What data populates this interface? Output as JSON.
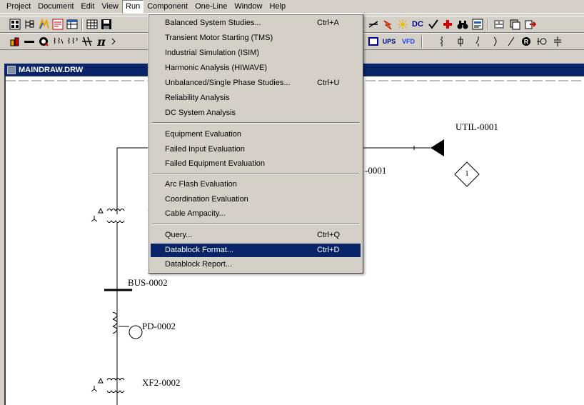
{
  "menubar": {
    "items": [
      "Project",
      "Document",
      "Edit",
      "View",
      "Run",
      "Component",
      "One-Line",
      "Window",
      "Help"
    ],
    "active": "Run"
  },
  "toolbar2": {
    "ups": "UPS",
    "vfd": "VFD"
  },
  "document": {
    "title": "MAINDRAW.DRW"
  },
  "diagram": {
    "util_label": "UTIL-0001",
    "util_partial_label": "-0001",
    "diamond_number": "1",
    "xf1_partial": "X",
    "bus_label": "BUS-0002",
    "pd_label": "PD-0002",
    "xf2_label": "XF2-0002"
  },
  "run_menu": {
    "items": [
      {
        "label": "Balanced System Studies...",
        "shortcut": "Ctrl+A"
      },
      {
        "label": "Transient Motor Starting (TMS)",
        "shortcut": ""
      },
      {
        "label": "Industrial Simulation (ISIM)",
        "shortcut": ""
      },
      {
        "label": "Harmonic Analysis (HIWAVE)",
        "shortcut": ""
      },
      {
        "label": "Unbalanced/Single Phase Studies...",
        "shortcut": "Ctrl+U"
      },
      {
        "label": "Reliability Analysis",
        "shortcut": ""
      },
      {
        "label": "DC System Analysis",
        "shortcut": ""
      },
      {
        "label": "Equipment Evaluation",
        "shortcut": ""
      },
      {
        "label": "Failed Input Evaluation",
        "shortcut": ""
      },
      {
        "label": "Failed Equipment Evaluation",
        "shortcut": ""
      },
      {
        "label": "Arc Flash Evaluation",
        "shortcut": ""
      },
      {
        "label": "Coordination Evaluation",
        "shortcut": ""
      },
      {
        "label": "Cable Ampacity...",
        "shortcut": ""
      },
      {
        "label": "Query...",
        "shortcut": "Ctrl+Q"
      },
      {
        "label": "Datablock Format...",
        "shortcut": "Ctrl+D"
      },
      {
        "label": "Datablock Report...",
        "shortcut": ""
      }
    ],
    "highlighted": "Datablock Format..."
  },
  "colors": {
    "menu_highlight": "#0a246a",
    "window_face": "#d4d0c8"
  }
}
